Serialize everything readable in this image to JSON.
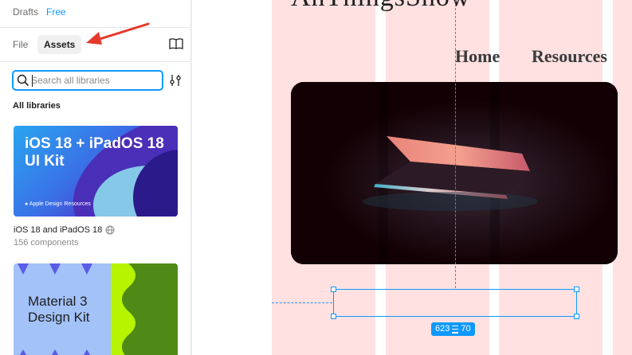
{
  "header": {
    "drafts_label": "Drafts",
    "plan_badge": "Free"
  },
  "tabs": {
    "file_label": "File",
    "assets_label": "Assets"
  },
  "search": {
    "placeholder": "Search all libraries",
    "value": ""
  },
  "libraries": {
    "heading": "All libraries",
    "items": [
      {
        "thumb_title": "iOS 18 + iPadOS 18\nUI Kit",
        "thumb_brand": "Apple Design Resources",
        "name": "iOS 18 and iPadOS 18",
        "count": "156 components"
      },
      {
        "thumb_title": "Material 3\nDesign Kit"
      }
    ]
  },
  "canvas": {
    "page_title": "AnThingsShow",
    "nav": {
      "home": "Home",
      "resources": "Resources"
    },
    "selection_size": {
      "width": "623",
      "height": "70"
    }
  },
  "colors": {
    "accent": "#0d99ff",
    "annotation_arrow": "#e5392b",
    "grid_column": "#ffe1e1"
  },
  "icons": [
    "search-icon",
    "book-icon",
    "filter-icon",
    "globe-icon",
    "apple-icon",
    "laptop-image",
    "annotation-arrow-icon"
  ]
}
